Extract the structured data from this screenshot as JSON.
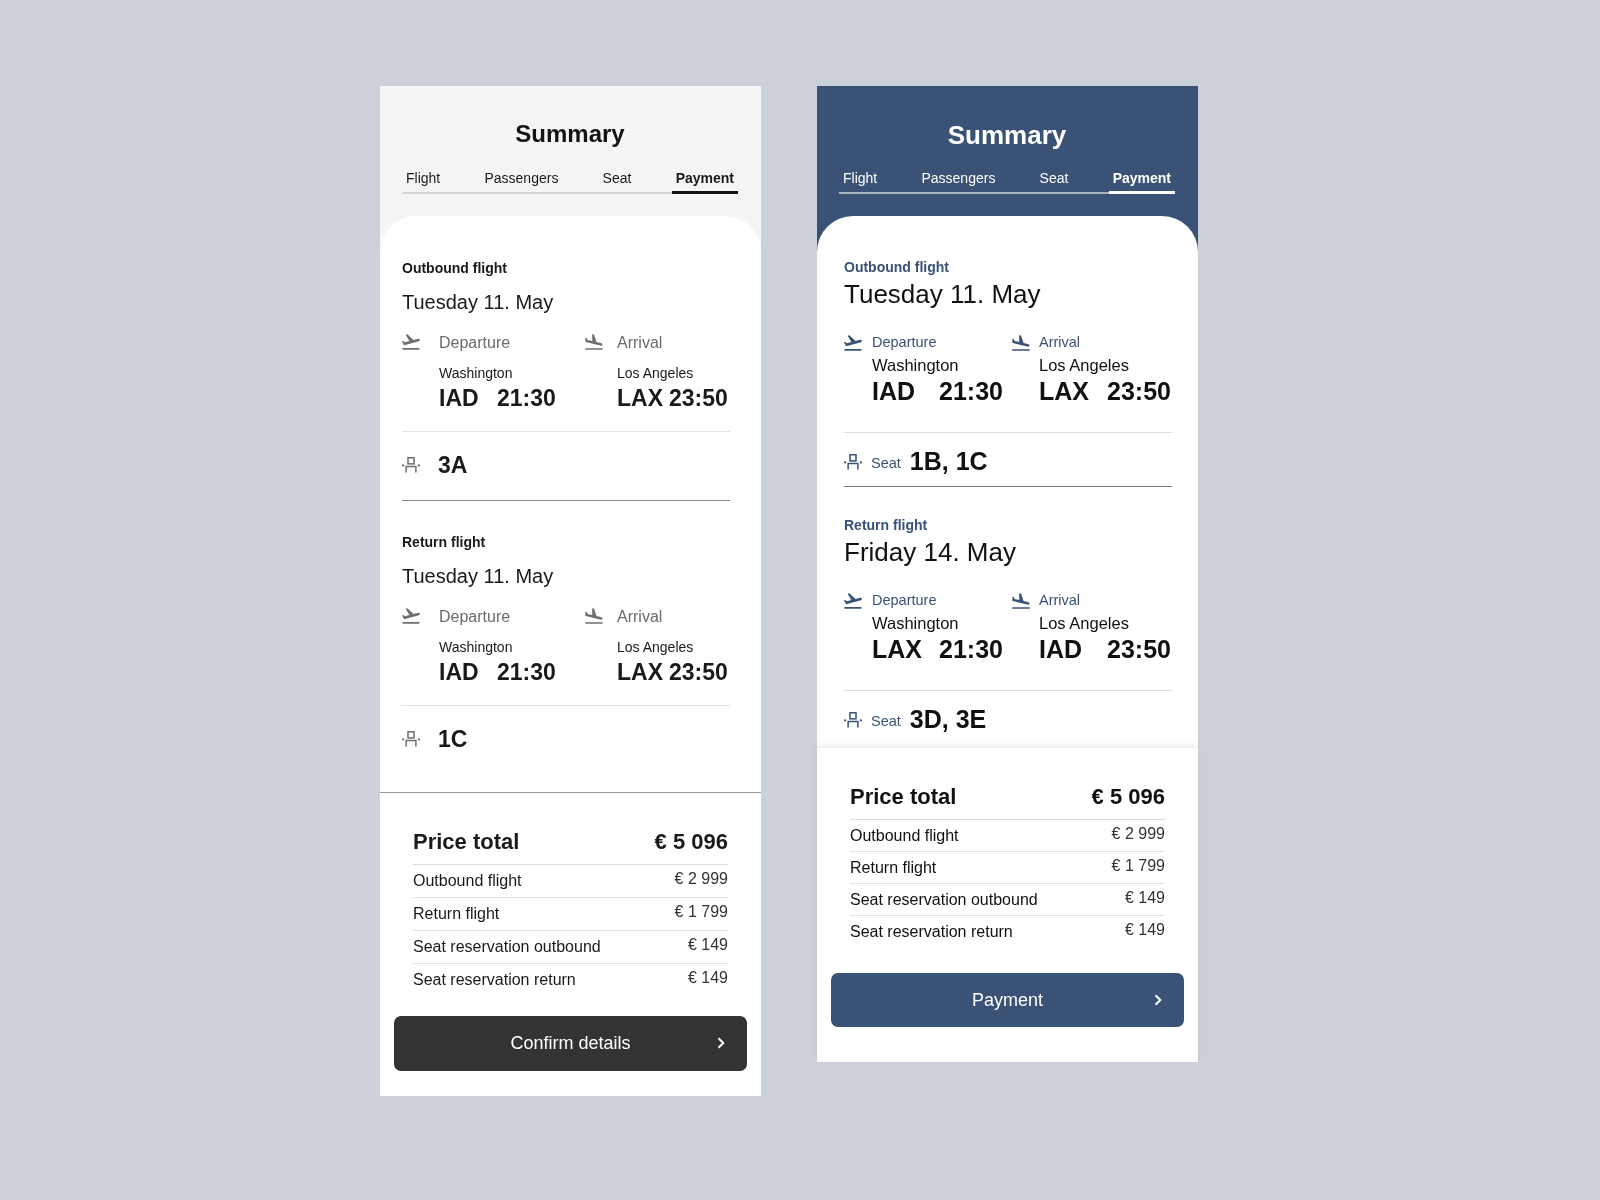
{
  "screens": [
    {
      "kind": "neutral",
      "title": "Summary",
      "tabs": [
        {
          "label": "Flight",
          "selected": false
        },
        {
          "label": "Passengers",
          "selected": false
        },
        {
          "label": "Seat",
          "selected": false
        },
        {
          "label": "Payment",
          "selected": true
        }
      ],
      "flights": [
        {
          "label": "Outbound flight",
          "date": "Tuesday 11. May",
          "departure": {
            "label": "Departure",
            "city": "Washington",
            "code": "IAD",
            "time": "21:30"
          },
          "arrival": {
            "label": "Arrival",
            "city": "Los Angeles",
            "code": "LAX",
            "time": "23:50"
          },
          "seat": {
            "value": "3A"
          }
        },
        {
          "label": "Return flight",
          "date": "Tuesday 11. May",
          "departure": {
            "label": "Departure",
            "city": "Washington",
            "code": "IAD",
            "time": "21:30"
          },
          "arrival": {
            "label": "Arrival",
            "city": "Los Angeles",
            "code": "LAX",
            "time": "23:50"
          },
          "seat": {
            "value": "1C"
          }
        }
      ],
      "price": {
        "label": "Price total",
        "total": "€ 5 096",
        "items": [
          {
            "label": "Outbound flight",
            "amount": "€ 2 999"
          },
          {
            "label": "Return flight",
            "amount": "€ 1 799"
          },
          {
            "label": "Seat reservation outbound",
            "amount": "€ 149"
          },
          {
            "label": "Seat reservation return",
            "amount": "€ 149"
          }
        ]
      },
      "button": {
        "label": "Confirm details"
      }
    },
    {
      "kind": "accent",
      "title": "Summary",
      "tabs": [
        {
          "label": "Flight",
          "selected": false
        },
        {
          "label": "Passengers",
          "selected": false
        },
        {
          "label": "Seat",
          "selected": false
        },
        {
          "label": "Payment",
          "selected": true
        }
      ],
      "flights": [
        {
          "label": "Outbound flight",
          "date": "Tuesday 11. May",
          "departure": {
            "label": "Departure",
            "city": "Washington",
            "code": "IAD",
            "time": "21:30"
          },
          "arrival": {
            "label": "Arrival",
            "city": "Los Angeles",
            "code": "LAX",
            "time": "23:50"
          },
          "seat": {
            "label": "Seat",
            "value": "1B, 1C"
          }
        },
        {
          "label": "Return flight",
          "date": "Friday 14. May",
          "departure": {
            "label": "Departure",
            "city": "Washington",
            "code": "LAX",
            "time": "21:30"
          },
          "arrival": {
            "label": "Arrival",
            "city": "Los Angeles",
            "code": "IAD",
            "time": "23:50"
          },
          "seat": {
            "label": "Seat",
            "value": "3D, 3E"
          }
        }
      ],
      "price": {
        "label": "Price total",
        "total": "€ 5 096",
        "items": [
          {
            "label": "Outbound flight",
            "amount": "€ 2 999"
          },
          {
            "label": "Return flight",
            "amount": "€ 1 799"
          },
          {
            "label": "Seat reservation outbound",
            "amount": "€ 149"
          },
          {
            "label": "Seat reservation return",
            "amount": "€ 149"
          }
        ]
      },
      "button": {
        "label": "Payment"
      }
    }
  ]
}
